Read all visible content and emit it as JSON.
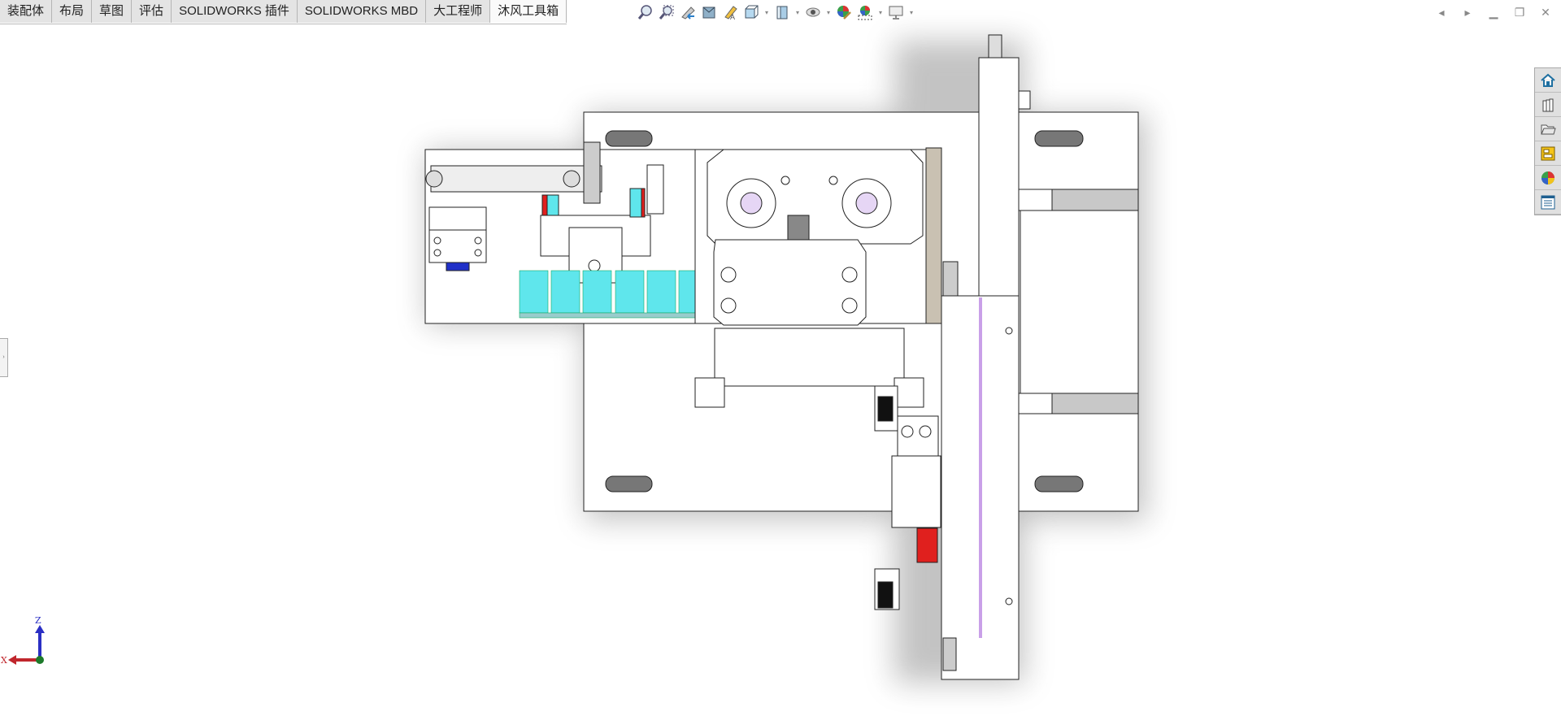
{
  "tabs": [
    {
      "label": "装配体",
      "active": false
    },
    {
      "label": "布局",
      "active": false
    },
    {
      "label": "草图",
      "active": false
    },
    {
      "label": "评估",
      "active": false
    },
    {
      "label": "SOLIDWORKS 插件",
      "active": false
    },
    {
      "label": "SOLIDWORKS MBD",
      "active": false
    },
    {
      "label": "大工程师",
      "active": false
    },
    {
      "label": "沐风工具箱",
      "active": true
    }
  ],
  "toolbar": {
    "icons": [
      "zoom-to-fit-icon",
      "zoom-to-area-icon",
      "previous-view-icon",
      "section-view-icon",
      "dynamic-annotation-view-icon",
      "view-orientation-icon",
      "display-style-icon",
      "hide-show-items-icon",
      "edit-appearance-icon",
      "apply-scene-icon",
      "view-settings-icon"
    ]
  },
  "window_controls": [
    "previous-document-icon",
    "next-document-icon",
    "minimize-icon",
    "restore-icon",
    "close-icon"
  ],
  "task_pane": [
    "solidworks-resources-icon",
    "design-library-icon",
    "file-explorer-icon",
    "view-palette-icon",
    "appearances-scenes-icon",
    "custom-properties-icon"
  ],
  "triad": {
    "x_label": "X",
    "z_label": "Z",
    "colors": {
      "x": "#c0262c",
      "z": "#2b2fc4",
      "origin": "#1d7a2a"
    }
  },
  "colors": {
    "accent_cyan": "#5fe6ec",
    "accent_red": "#e0201e",
    "accent_blue": "#2030c8",
    "purple": "#c9a0e8"
  }
}
